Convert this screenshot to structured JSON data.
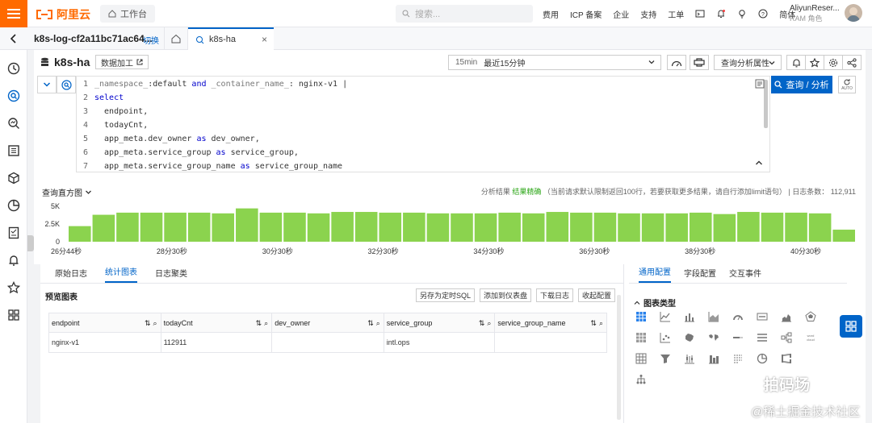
{
  "topbar": {
    "logo_text": "阿里云",
    "workbench": "工作台",
    "search_placeholder": "搜索...",
    "nav": [
      "费用",
      "ICP 备案",
      "企业",
      "支持",
      "工单"
    ],
    "lang": "简体",
    "account_name": "AliyunReser...",
    "account_role": "RAM 角色"
  },
  "tabbar": {
    "project": "k8s-log-cf2a11bc71ac64...",
    "switch": "切换",
    "doc_tab": "k8s-ha"
  },
  "header": {
    "logstore": "k8s-ha",
    "data_processing": "数据加工",
    "time_tag": "15min",
    "time_label": "最近15分钟",
    "query_attr": "查询分析属性"
  },
  "editor": {
    "lines": [
      {
        "n": "1",
        "t": "_namespace_:default and _container_name_: nginx-v1 |"
      },
      {
        "n": "2",
        "t": "select"
      },
      {
        "n": "3",
        "t": "  endpoint,"
      },
      {
        "n": "4",
        "t": "  todayCnt,"
      },
      {
        "n": "5",
        "t": "  app_meta.dev_owner as dev_owner,"
      },
      {
        "n": "6",
        "t": "  app_meta.service_group as service_group,"
      },
      {
        "n": "7",
        "t": "  app_meta.service_group_name as service_group_name"
      }
    ],
    "query_button": "查询 / 分析",
    "auto_label": "AUTO"
  },
  "histogram": {
    "title": "查询直方图",
    "status_prefix": "分析结果",
    "status_ok": "结果精确",
    "status_note": "（当前请求默认限制返回100行，若要获取更多结果，请自行添加limit语句）",
    "count_label": "日志条数：",
    "count": "112,911"
  },
  "chart_data": {
    "type": "bar",
    "y_ticks": [
      "5K",
      "2.5K",
      "0"
    ],
    "ylim": [
      0,
      5000
    ],
    "x_ticks": [
      "26分44秒",
      "28分30秒",
      "30分30秒",
      "32分30秒",
      "34分30秒",
      "36分30秒",
      "38分30秒",
      "40分30秒"
    ],
    "values": [
      2200,
      3800,
      4100,
      4100,
      4100,
      4100,
      4000,
      4700,
      4100,
      4100,
      4000,
      4200,
      4200,
      4100,
      4100,
      4000,
      4000,
      4000,
      4100,
      4000,
      4200,
      4100,
      4100,
      4000,
      4000,
      4000,
      4100,
      3900,
      4200,
      4100,
      4100,
      4000,
      1700
    ],
    "color": "#8bd34e"
  },
  "results": {
    "tabs": [
      "原始日志",
      "统计图表",
      "日志聚类"
    ],
    "active_tab": 1,
    "preview_title": "预览图表",
    "actions": [
      "另存为定时SQL",
      "添加到仪表盘",
      "下载日志",
      "收起配置"
    ],
    "columns": [
      "endpoint",
      "todayCnt",
      "dev_owner",
      "service_group",
      "service_group_name"
    ],
    "rows": [
      [
        "nginx-v1",
        "112911",
        "",
        "intl.ops",
        ""
      ]
    ]
  },
  "config": {
    "tabs": [
      "通用配置",
      "字段配置",
      "交互事件"
    ],
    "section": "图表类型"
  },
  "watermark": {
    "line1": "拍码场",
    "line2": "@稀土掘金技术社区"
  }
}
